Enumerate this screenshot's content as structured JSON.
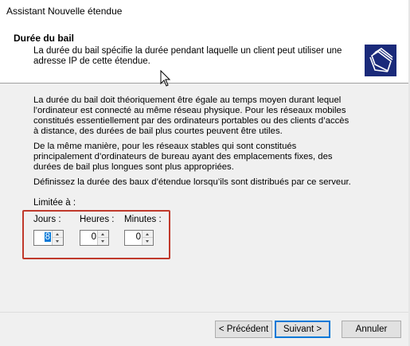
{
  "window": {
    "title": "Assistant Nouvelle étendue"
  },
  "header": {
    "title": "Durée du bail",
    "description": "La durée du bail spécifie la durée pendant laquelle un client peut utiliser une adresse IP de cette étendue.",
    "icon": "folders-icon"
  },
  "body": {
    "paragraphs": [
      "La durée du bail doit théoriquement être égale au temps moyen durant lequel l’ordinateur est connecté au même réseau physique. Pour les réseaux mobiles constitués essentiellement par des ordinateurs portables ou des clients d’accès à distance, des durées de bail plus courtes peuvent être utiles.",
      "De la même manière, pour les réseaux stables qui sont constitués principalement d’ordinateurs de bureau ayant des emplacements fixes, des durées de bail plus longues sont plus appropriées.",
      "Définissez la durée des baux d’étendue lorsqu’ils sont distribués par ce serveur."
    ],
    "limit_label": "Limitée à :"
  },
  "lease": {
    "days": {
      "label": "Jours :",
      "value": "8"
    },
    "hours": {
      "label": "Heures :",
      "value": "0"
    },
    "minutes": {
      "label": "Minutes :",
      "value": "0"
    }
  },
  "buttons": {
    "back": "< Précédent",
    "next": "Suivant >",
    "cancel": "Annuler"
  },
  "colors": {
    "highlight_box": "#c0392b",
    "selection": "#0078d7"
  }
}
